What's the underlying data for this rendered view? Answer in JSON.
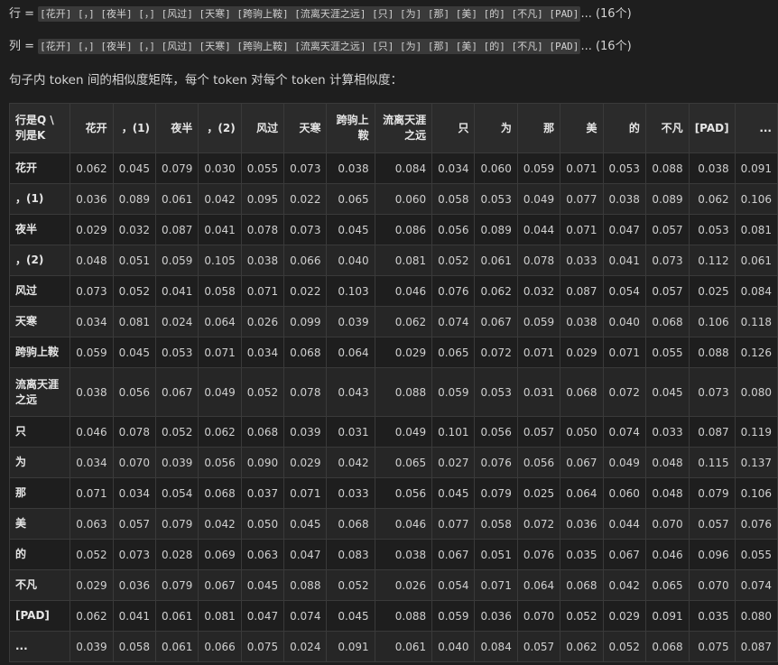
{
  "row_line": {
    "prefix": "行 = ",
    "tokens": "[花开] [，] [夜半] [，] [风过] [天寒] [跨驹上鞍] [流离天涯之远] [只] [为] [那] [美] [的] [不凡] [PAD]",
    "suffix": "... (16个)"
  },
  "col_line": {
    "prefix": "列 = ",
    "tokens": "[花开] [，] [夜半] [，] [风过] [天寒] [跨驹上鞍] [流离天涯之远] [只] [为] [那] [美] [的] [不凡] [PAD]",
    "suffix": "... (16个)"
  },
  "description": "句子内 token 间的相似度矩阵，每个 token 对每个 token 计算相似度：",
  "matrix": {
    "corner": "行是Q \\ 列是K",
    "columns": [
      "花开",
      "，(1)",
      "夜半",
      "，(2)",
      "风过",
      "天寒",
      "跨驹上鞍",
      "流离天涯之远",
      "只",
      "为",
      "那",
      "美",
      "的",
      "不凡",
      "[PAD]",
      "..."
    ],
    "rows": [
      {
        "label": "花开",
        "values": [
          "0.062",
          "0.045",
          "0.079",
          "0.030",
          "0.055",
          "0.073",
          "0.038",
          "0.084",
          "0.034",
          "0.060",
          "0.059",
          "0.071",
          "0.053",
          "0.088",
          "0.038",
          "0.091"
        ]
      },
      {
        "label": "，(1)",
        "values": [
          "0.036",
          "0.089",
          "0.061",
          "0.042",
          "0.095",
          "0.022",
          "0.065",
          "0.060",
          "0.058",
          "0.053",
          "0.049",
          "0.077",
          "0.038",
          "0.089",
          "0.062",
          "0.106"
        ]
      },
      {
        "label": "夜半",
        "values": [
          "0.029",
          "0.032",
          "0.087",
          "0.041",
          "0.078",
          "0.073",
          "0.045",
          "0.086",
          "0.056",
          "0.089",
          "0.044",
          "0.071",
          "0.047",
          "0.057",
          "0.053",
          "0.081"
        ]
      },
      {
        "label": "，(2)",
        "values": [
          "0.048",
          "0.051",
          "0.059",
          "0.105",
          "0.038",
          "0.066",
          "0.040",
          "0.081",
          "0.052",
          "0.061",
          "0.078",
          "0.033",
          "0.041",
          "0.073",
          "0.112",
          "0.061"
        ]
      },
      {
        "label": "风过",
        "values": [
          "0.073",
          "0.052",
          "0.041",
          "0.058",
          "0.071",
          "0.022",
          "0.103",
          "0.046",
          "0.076",
          "0.062",
          "0.032",
          "0.087",
          "0.054",
          "0.057",
          "0.025",
          "0.084"
        ]
      },
      {
        "label": "天寒",
        "values": [
          "0.034",
          "0.081",
          "0.024",
          "0.064",
          "0.026",
          "0.099",
          "0.039",
          "0.062",
          "0.074",
          "0.067",
          "0.059",
          "0.038",
          "0.040",
          "0.068",
          "0.106",
          "0.118"
        ]
      },
      {
        "label": "跨驹上鞍",
        "values": [
          "0.059",
          "0.045",
          "0.053",
          "0.071",
          "0.034",
          "0.068",
          "0.064",
          "0.029",
          "0.065",
          "0.072",
          "0.071",
          "0.029",
          "0.071",
          "0.055",
          "0.088",
          "0.126"
        ]
      },
      {
        "label": "流离天涯之远",
        "values": [
          "0.038",
          "0.056",
          "0.067",
          "0.049",
          "0.052",
          "0.078",
          "0.043",
          "0.088",
          "0.059",
          "0.053",
          "0.031",
          "0.068",
          "0.072",
          "0.045",
          "0.073",
          "0.080"
        ]
      },
      {
        "label": "只",
        "values": [
          "0.046",
          "0.078",
          "0.052",
          "0.062",
          "0.068",
          "0.039",
          "0.031",
          "0.049",
          "0.101",
          "0.056",
          "0.057",
          "0.050",
          "0.074",
          "0.033",
          "0.087",
          "0.119"
        ]
      },
      {
        "label": "为",
        "values": [
          "0.034",
          "0.070",
          "0.039",
          "0.056",
          "0.090",
          "0.029",
          "0.042",
          "0.065",
          "0.027",
          "0.076",
          "0.056",
          "0.067",
          "0.049",
          "0.048",
          "0.115",
          "0.137"
        ]
      },
      {
        "label": "那",
        "values": [
          "0.071",
          "0.034",
          "0.054",
          "0.068",
          "0.037",
          "0.071",
          "0.033",
          "0.056",
          "0.045",
          "0.079",
          "0.025",
          "0.064",
          "0.060",
          "0.048",
          "0.079",
          "0.106"
        ]
      },
      {
        "label": "美",
        "values": [
          "0.063",
          "0.057",
          "0.079",
          "0.042",
          "0.050",
          "0.045",
          "0.068",
          "0.046",
          "0.077",
          "0.058",
          "0.072",
          "0.036",
          "0.044",
          "0.070",
          "0.057",
          "0.076"
        ]
      },
      {
        "label": "的",
        "values": [
          "0.052",
          "0.073",
          "0.028",
          "0.069",
          "0.063",
          "0.047",
          "0.083",
          "0.038",
          "0.067",
          "0.051",
          "0.076",
          "0.035",
          "0.067",
          "0.046",
          "0.096",
          "0.055"
        ]
      },
      {
        "label": "不凡",
        "values": [
          "0.029",
          "0.036",
          "0.079",
          "0.067",
          "0.045",
          "0.088",
          "0.052",
          "0.026",
          "0.054",
          "0.071",
          "0.064",
          "0.068",
          "0.042",
          "0.065",
          "0.070",
          "0.074"
        ]
      },
      {
        "label": "[PAD]",
        "values": [
          "0.062",
          "0.041",
          "0.061",
          "0.081",
          "0.047",
          "0.074",
          "0.045",
          "0.088",
          "0.059",
          "0.036",
          "0.070",
          "0.052",
          "0.029",
          "0.091",
          "0.035",
          "0.080"
        ]
      },
      {
        "label": "...",
        "values": [
          "0.039",
          "0.058",
          "0.061",
          "0.066",
          "0.075",
          "0.024",
          "0.091",
          "0.061",
          "0.040",
          "0.084",
          "0.057",
          "0.062",
          "0.052",
          "0.068",
          "0.075",
          "0.087"
        ]
      }
    ]
  }
}
